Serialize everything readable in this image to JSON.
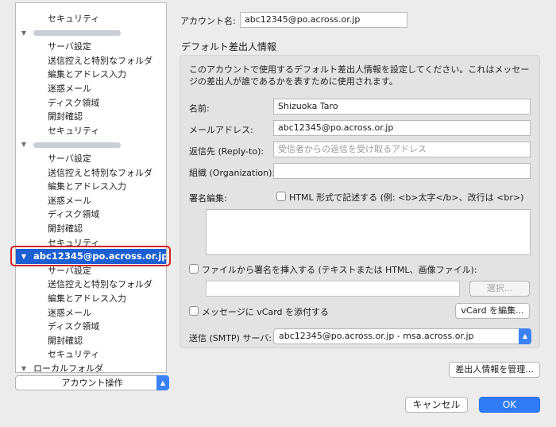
{
  "sidebar": {
    "items": [
      {
        "type": "child",
        "label": "セキュリティ"
      },
      {
        "type": "account",
        "redacted": true
      },
      {
        "type": "child",
        "label": "サーバ設定"
      },
      {
        "type": "child",
        "label": "送信控えと特別なフォルダ"
      },
      {
        "type": "child",
        "label": "編集とアドレス入力"
      },
      {
        "type": "child",
        "label": "迷惑メール"
      },
      {
        "type": "child",
        "label": "ディスク領域"
      },
      {
        "type": "child",
        "label": "開封確認"
      },
      {
        "type": "child",
        "label": "セキュリティ"
      },
      {
        "type": "account",
        "redacted": true
      },
      {
        "type": "child",
        "label": "サーバ設定"
      },
      {
        "type": "child",
        "label": "送信控えと特別なフォルダ"
      },
      {
        "type": "child",
        "label": "編集とアドレス入力"
      },
      {
        "type": "child",
        "label": "迷惑メール"
      },
      {
        "type": "child",
        "label": "ディスク領域"
      },
      {
        "type": "child",
        "label": "開封確認"
      },
      {
        "type": "child",
        "label": "セキュリティ"
      },
      {
        "type": "account",
        "label": "abc12345@po.across.or.jp",
        "selected": true
      },
      {
        "type": "child",
        "label": "サーバ設定"
      },
      {
        "type": "child",
        "label": "送信控えと特別なフォルダ"
      },
      {
        "type": "child",
        "label": "編集とアドレス入力"
      },
      {
        "type": "child",
        "label": "迷惑メール"
      },
      {
        "type": "child",
        "label": "ディスク領域"
      },
      {
        "type": "child",
        "label": "開封確認"
      },
      {
        "type": "child",
        "label": "セキュリティ"
      },
      {
        "type": "account",
        "label": "ローカルフォルダ"
      }
    ],
    "account_ops": "アカウント操作",
    "selection_color": "#1a5fd3",
    "highlight_color": "#d0202a"
  },
  "account": {
    "name_label": "アカウント名:",
    "name_value": "abc12345@po.across.or.jp"
  },
  "identity": {
    "title": "デフォルト差出人情報",
    "description": "このアカウントで使用するデフォルト差出人情報を設定してください。これはメッセージの差出人が誰であるかを表すために使用されます。",
    "name_label": "名前:",
    "name_value": "Shizuoka Taro",
    "email_label": "メールアドレス:",
    "email_value": "abc12345@po.across.or.jp",
    "replyto_label": "返信先 (Reply-to):",
    "replyto_placeholder": "受信者からの返信を受け取るアドレス",
    "org_label": "組織 (Organization):",
    "org_value": "",
    "signature_label": "署名編集:",
    "html_checkbox_label": "HTML 形式で記述する (例: <b>太字</b>、改行は <br>)",
    "sigfile_checkbox_label": "ファイルから署名を挿入する (テキストまたは HTML、画像ファイル):",
    "choose_button": "選択...",
    "vcard_checkbox_label": "メッセージに vCard を添付する",
    "vcard_button": "vCard を編集...",
    "smtp_label": "送信 (SMTP) サーバ:",
    "smtp_value": "abc12345@po.across.or.jp - msa.across.or.jp"
  },
  "buttons": {
    "manage_identities": "差出人情報を管理...",
    "cancel": "キャンセル",
    "ok": "OK"
  },
  "icons": {
    "stepper": "⌃⌄",
    "disclosure": "▼"
  }
}
